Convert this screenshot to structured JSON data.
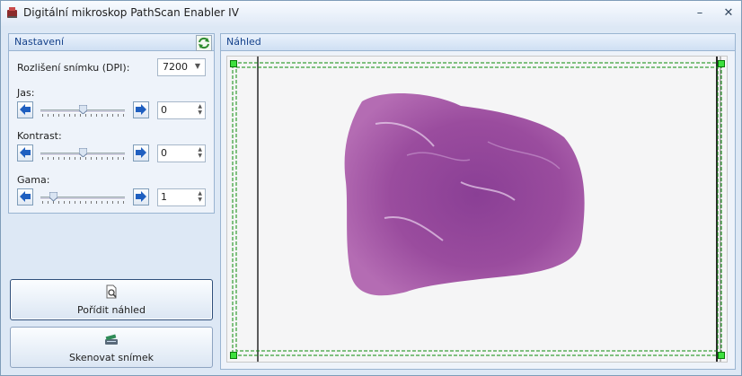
{
  "window": {
    "title": "Digitální mikroskop PathScan Enabler IV",
    "minimize_icon": "minimize-icon",
    "close_icon": "close-icon"
  },
  "settings": {
    "header": "Nastavení",
    "refresh_icon": "refresh-icon",
    "resolution_label": "Rozlišení snímku (DPI):",
    "resolution_value": "7200",
    "brightness": {
      "label": "Jas:",
      "value": "0",
      "level": 0.5
    },
    "contrast": {
      "label": "Kontrast:",
      "value": "0",
      "level": 0.5
    },
    "gamma": {
      "label": "Gama:",
      "value": "1",
      "level": 0.15
    }
  },
  "buttons": {
    "preview_label": "Pořídit náhled",
    "preview_icon": "magnifier-document-icon",
    "scan_label": "Skenovat snímek",
    "scan_icon": "scanner-icon"
  },
  "preview": {
    "header": "Náhled"
  },
  "colors": {
    "accent_header_text": "#15428b",
    "selection_line": "#0a8a0a",
    "selection_handle": "#3ee03e",
    "tissue": "#9a4c9e"
  }
}
